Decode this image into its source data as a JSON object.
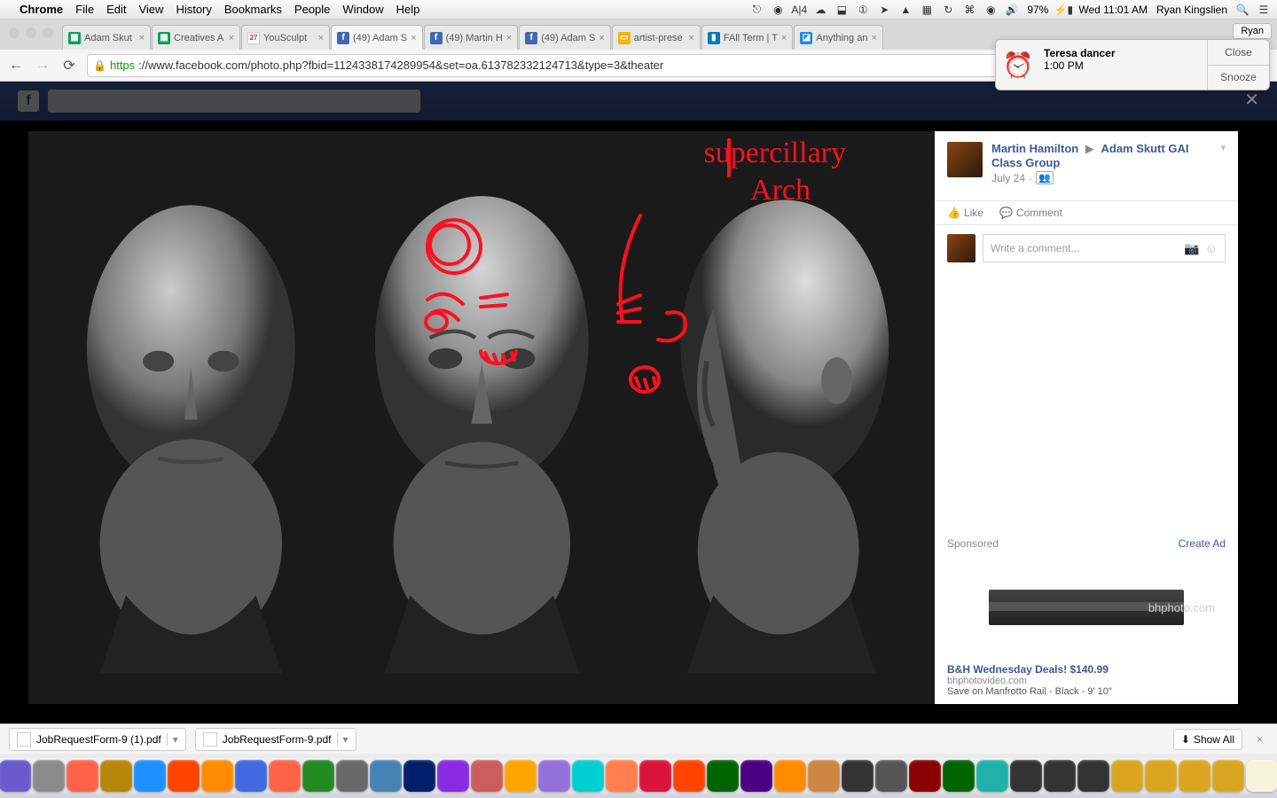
{
  "menubar": {
    "app": "Chrome",
    "items": [
      "File",
      "Edit",
      "View",
      "History",
      "Bookmarks",
      "People",
      "Window",
      "Help"
    ],
    "right": {
      "battery": "97%",
      "clock": "Wed 11:01 AM",
      "user": "Ryan Kingslien"
    }
  },
  "tabs": [
    {
      "favicon": "sheets",
      "label": "Adam Skut"
    },
    {
      "favicon": "sheets",
      "label": "Creatives A"
    },
    {
      "favicon": "cal",
      "label": "YouSculpt",
      "badge": "27"
    },
    {
      "favicon": "fb",
      "label": "(49) Adam S",
      "active": true
    },
    {
      "favicon": "fb",
      "label": "(49) Martin H"
    },
    {
      "favicon": "fb",
      "label": "(49) Adam S"
    },
    {
      "favicon": "slides",
      "label": "artist-prese"
    },
    {
      "favicon": "trello",
      "label": "FAll Term | T"
    },
    {
      "favicon": "ff",
      "label": "Anything an"
    }
  ],
  "user_button": "Ryan",
  "url": {
    "scheme": "https",
    "rest": "://www.facebook.com/photo.php?fbid=1124338174289954&set=oa.613782332124713&type=3&theater"
  },
  "notification": {
    "title": "Teresa dancer",
    "time": "1:00 PM",
    "close": "Close",
    "snooze": "Snooze"
  },
  "post": {
    "author": "Martin Hamilton",
    "group": "Adam Skutt GAI Class Group",
    "date": "July 24",
    "like": "Like",
    "comment": "Comment",
    "comment_placeholder": "Write a comment..."
  },
  "annotation_text_1": "supercillary",
  "annotation_text_2": "Arch",
  "sponsored": {
    "label": "Sponsored",
    "create": "Create Ad",
    "watermark": "bhphoto.com",
    "title": "B&H Wednesday Deals! $140.99",
    "domain": "bhphotovideo.com",
    "desc": "Save on Manfrotto Rail - Black - 9' 10\""
  },
  "downloads": {
    "items": [
      "JobRequestForm-9 (1).pdf",
      "JobRequestForm-9.pdf"
    ],
    "showall": "Show All"
  },
  "dock_colors": [
    "#2a7fff",
    "#6a5acd",
    "#8b8b8b",
    "#ff6347",
    "#b8860b",
    "#1e90ff",
    "#ff4500",
    "#ff8c00",
    "#4169e1",
    "#ff6347",
    "#228b22",
    "#696969",
    "#4682b4",
    "#001f6b",
    "#8a2be2",
    "#cd5c5c",
    "#ffa500",
    "#9370db",
    "#00ced1",
    "#ff7f50",
    "#dc143c",
    "#ff4500",
    "#006400",
    "#4b0082",
    "#ff8c00",
    "#cd853f",
    "#333",
    "#555",
    "#8b0000",
    "#006400",
    "#20b2aa",
    "#333",
    "#333",
    "#333",
    "#daa520",
    "#daa520",
    "#daa520",
    "#daa520",
    "#f5f5dc",
    "#555"
  ]
}
